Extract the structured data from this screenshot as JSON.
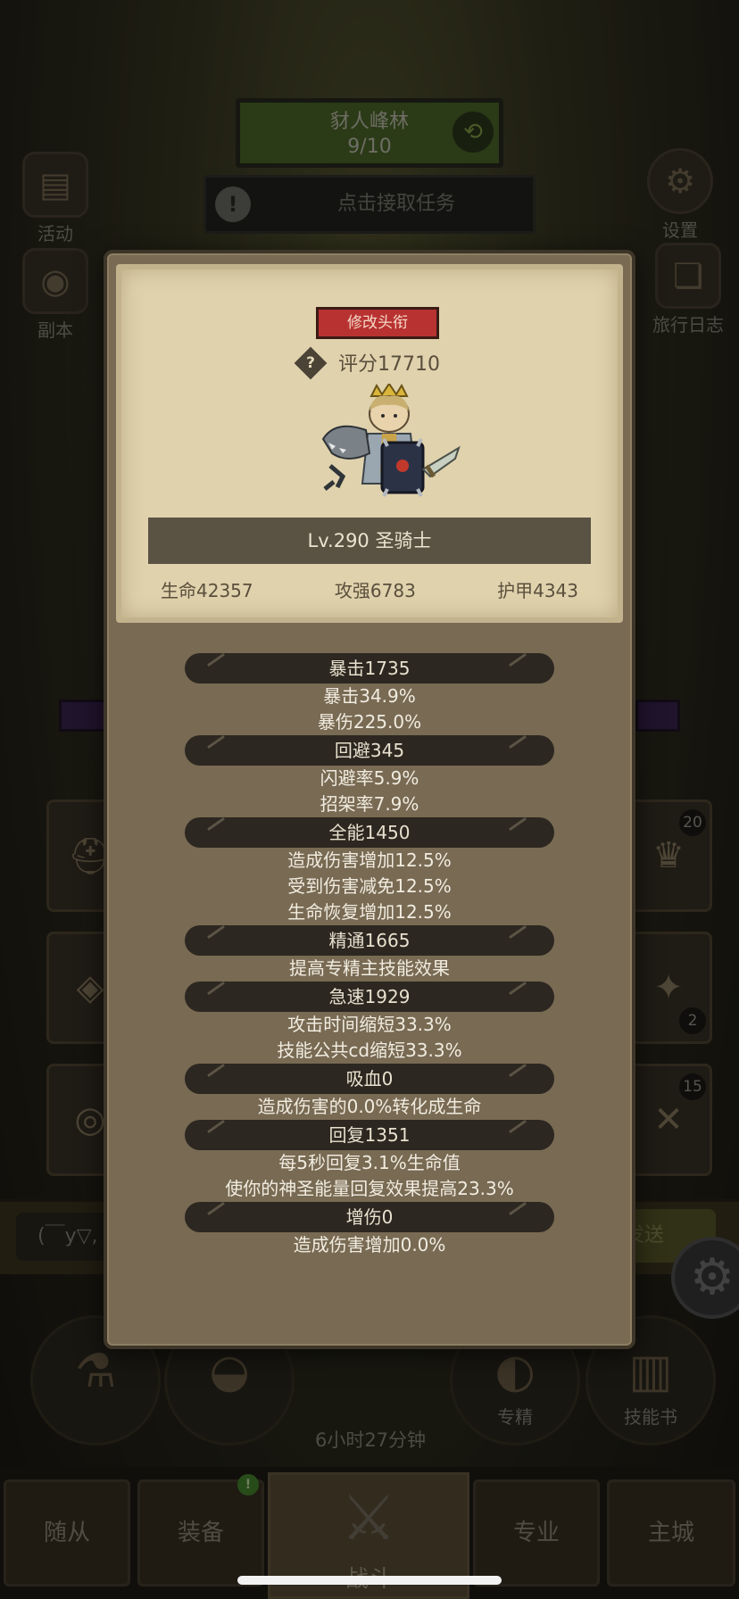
{
  "background": {
    "area_name": "豺人峰林",
    "area_progress": "9/10",
    "quest_text": "点击接取任务",
    "side_left": [
      {
        "label": "活动",
        "icon": "activity-book-icon"
      },
      {
        "label": "副本",
        "icon": "dungeon-portal-icon"
      }
    ],
    "side_right": [
      {
        "label": "设置",
        "icon": "gear-icon"
      },
      {
        "label": "旅行日志",
        "icon": "journal-icon"
      }
    ],
    "slot_counts": [
      "20",
      "2",
      "15"
    ],
    "chat_input": "(￣y▽,",
    "chat_send": "发送",
    "skills": [
      {
        "label": "",
        "icon": "potion-icon"
      },
      {
        "label": "",
        "icon": "bread-icon"
      },
      {
        "label": "专精",
        "icon": "specialization-icon"
      },
      {
        "label": "技能书",
        "icon": "skill-book-icon"
      }
    ],
    "chest_timer": "6小时27分钟",
    "nav": {
      "followers": "随从",
      "equipment": "装备",
      "battle": "战斗",
      "profession": "专业",
      "main_city": "主城",
      "notify": "!"
    }
  },
  "panel": {
    "change_title_button": "修改头衔",
    "help_icon": "?",
    "score": "评分17710",
    "level_class": "Lv.290 圣骑士",
    "core": {
      "hp": "生命42357",
      "attack": "攻强6783",
      "armor": "护甲4343"
    },
    "sections": [
      {
        "head": "暴击1735",
        "lines": [
          "暴击34.9%",
          "暴伤225.0%"
        ]
      },
      {
        "head": "回避345",
        "lines": [
          "闪避率5.9%",
          "招架率7.9%"
        ]
      },
      {
        "head": "全能1450",
        "lines": [
          "造成伤害增加12.5%",
          "受到伤害减免12.5%",
          "生命恢复增加12.5%"
        ]
      },
      {
        "head": "精通1665",
        "lines": [
          "提高专精主技能效果"
        ]
      },
      {
        "head": "急速1929",
        "lines": [
          "攻击时间缩短33.3%",
          "技能公共cd缩短33.3%"
        ]
      },
      {
        "head": "吸血0",
        "lines": [
          "造成伤害的0.0%转化成生命"
        ]
      },
      {
        "head": "回复1351",
        "lines": [
          "每5秒回复3.1%生命值",
          "使你的神圣能量回复效果提高23.3%"
        ]
      },
      {
        "head": "增伤0",
        "lines": [
          "造成伤害增加0.0%"
        ]
      }
    ]
  },
  "colors": {
    "panel_bg": "#786a53",
    "parchment": "#dfd2ad",
    "title_button": "#b93232",
    "stat_header": "#2c2720"
  }
}
